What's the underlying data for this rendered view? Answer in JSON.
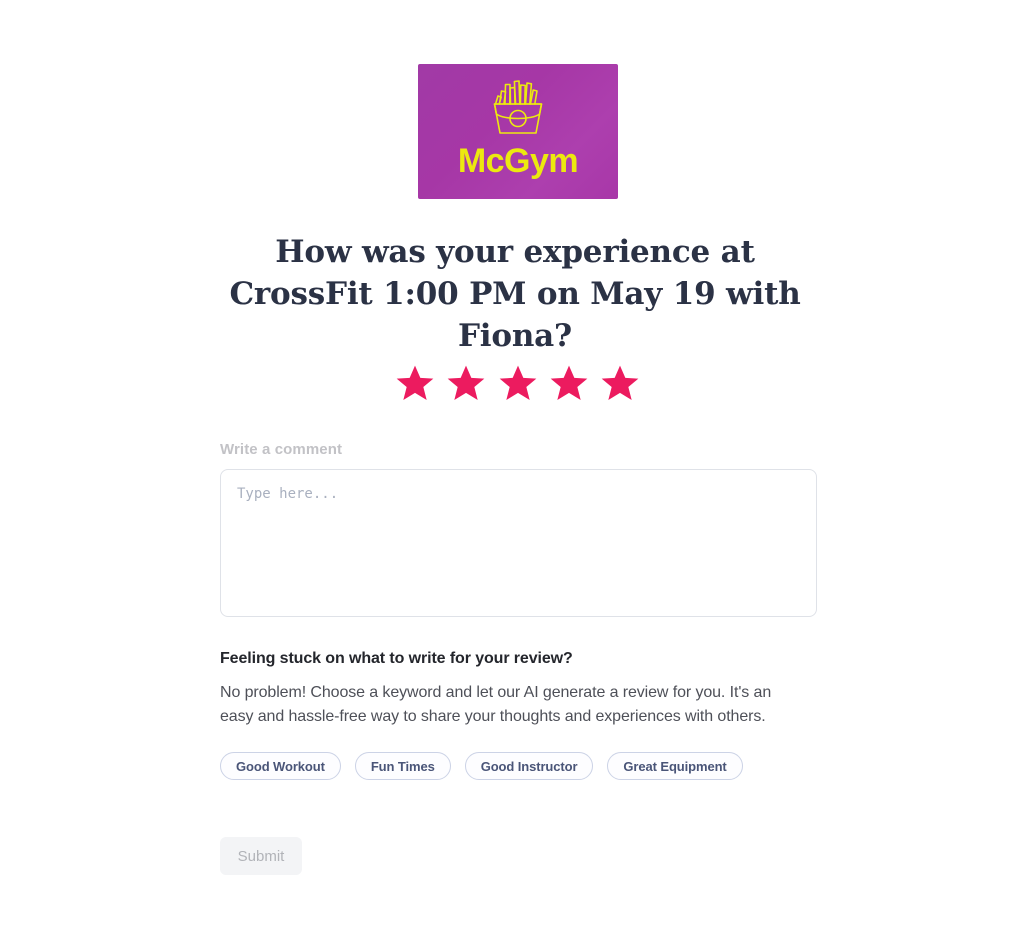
{
  "brand": {
    "logo_text": "McGym",
    "logo_icon": "french-fries-icon",
    "logo_background_start": "#a13aa6",
    "logo_background_end": "#a837a8",
    "logo_text_color": "#ece90f"
  },
  "headline": "How was your experience at CrossFit 1:00 PM on May 19 with Fiona?",
  "rating": {
    "icon": "star-icon",
    "value": 5,
    "max": 5,
    "color": "#ec1b5f",
    "stars": [
      {
        "label": "1 star",
        "filled": true
      },
      {
        "label": "2 stars",
        "filled": true
      },
      {
        "label": "3 stars",
        "filled": true
      },
      {
        "label": "4 stars",
        "filled": true
      },
      {
        "label": "5 stars",
        "filled": true
      }
    ]
  },
  "comment": {
    "label": "Write a comment",
    "placeholder": "Type here...",
    "value": ""
  },
  "help": {
    "title": "Feeling stuck on what to write for your review?",
    "body": "No problem! Choose a keyword and let our AI generate a review for you. It's an easy and hassle-free way to share your thoughts and experiences with others.",
    "keywords": [
      {
        "label": "Good Workout"
      },
      {
        "label": "Fun Times"
      },
      {
        "label": "Good Instructor"
      },
      {
        "label": "Great Equipment"
      }
    ]
  },
  "submit": {
    "label": "Submit",
    "enabled": false
  }
}
